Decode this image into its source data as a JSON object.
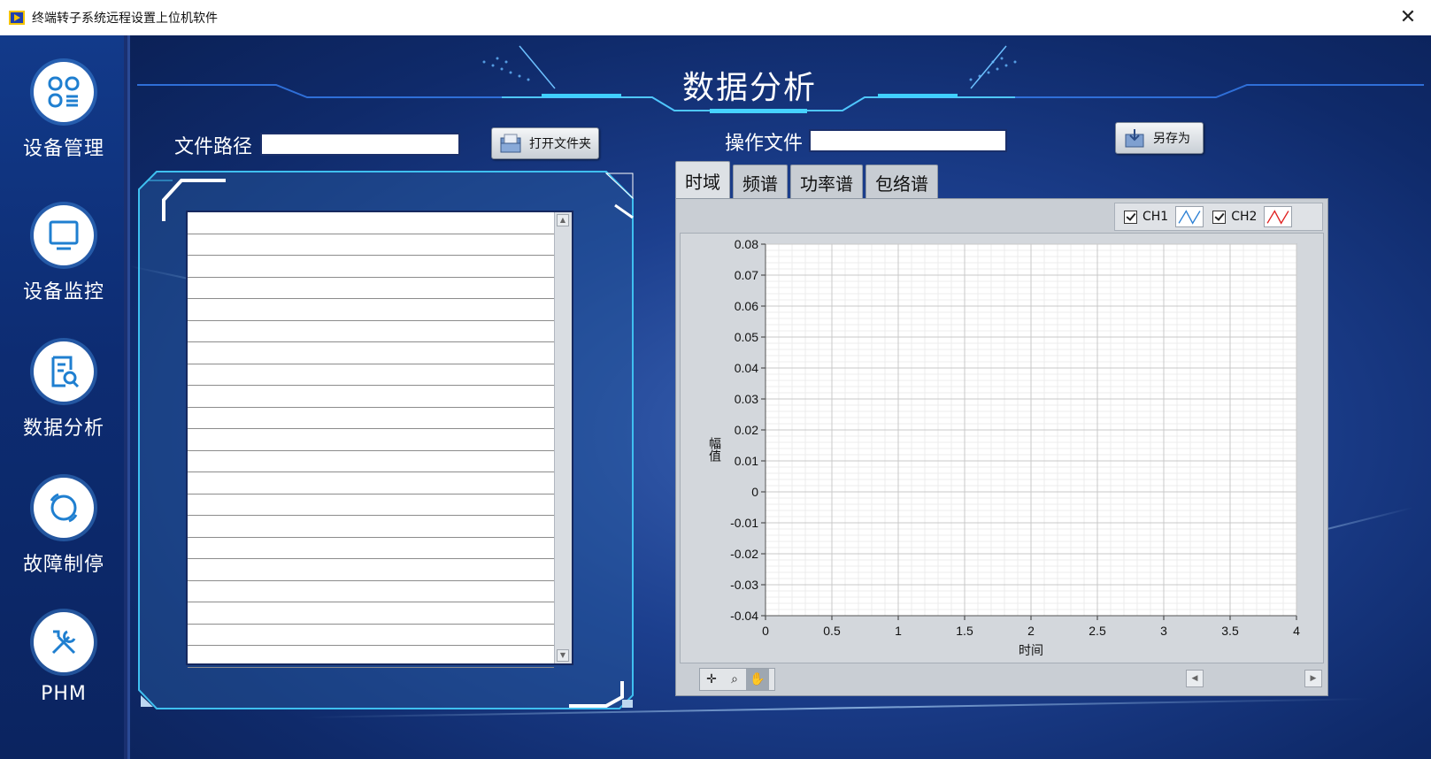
{
  "window": {
    "title": "终端转子系统远程设置上位机软件",
    "close": "✕"
  },
  "sidebar": {
    "items": [
      {
        "label": "设备管理",
        "icon": "grid-icon"
      },
      {
        "label": "设备监控",
        "icon": "monitor-icon"
      },
      {
        "label": "数据分析",
        "icon": "report-search-icon"
      },
      {
        "label": "故障制停",
        "icon": "ring-icon"
      },
      {
        "label": "PHM",
        "icon": "tools-icon"
      }
    ]
  },
  "page": {
    "title": "数据分析"
  },
  "file_path": {
    "label": "文件路径",
    "value": ""
  },
  "open_folder": {
    "label": "打开文件夹"
  },
  "operation_file": {
    "label": "操作文件",
    "value": ""
  },
  "save_as": {
    "label": "另存为"
  },
  "tabs": [
    {
      "label": "时域",
      "active": true
    },
    {
      "label": "频谱",
      "active": false
    },
    {
      "label": "功率谱",
      "active": false
    },
    {
      "label": "包络谱",
      "active": false
    }
  ],
  "legend": [
    {
      "name": "CH1",
      "checked": true,
      "color": "#2a7fd4"
    },
    {
      "name": "CH2",
      "checked": true,
      "color": "#e02020"
    }
  ],
  "chart_data": {
    "type": "line",
    "xlabel": "时间",
    "ylabel": "幅值",
    "xlim": [
      0,
      4
    ],
    "ylim": [
      -0.04,
      0.08
    ],
    "x_ticks": [
      "0",
      "0.5",
      "1",
      "1.5",
      "2",
      "2.5",
      "3",
      "3.5",
      "4"
    ],
    "y_ticks": [
      "0.08",
      "0.07",
      "0.06",
      "0.05",
      "0.04",
      "0.03",
      "0.02",
      "0.01",
      "0",
      "-0.01",
      "-0.02",
      "-0.03",
      "-0.04"
    ],
    "grid": true,
    "series": [
      {
        "name": "CH1",
        "values": []
      },
      {
        "name": "CH2",
        "values": []
      }
    ]
  },
  "colors": {
    "accent": "#3fd0ff",
    "background": "#0f2a6a",
    "panel": "#c9ced4"
  }
}
